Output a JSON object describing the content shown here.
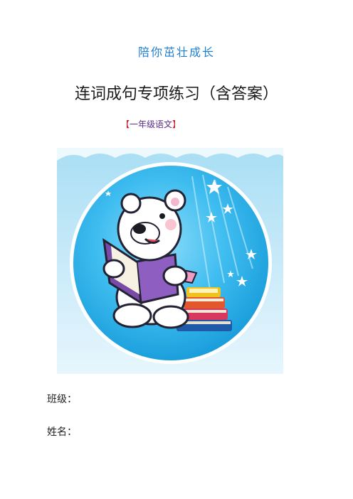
{
  "slogan": "陪你茁壮成长",
  "title": "连词成句专项练习（含答案）",
  "tag": {
    "open": "【",
    "text": "一年级语文",
    "close": "】"
  },
  "fields": {
    "class_label": "班级：",
    "name_label": "姓名："
  },
  "colors": {
    "slogan": "#1f7fd0",
    "tag_text": "#5a2a8a",
    "tag_bracket": "#c8242b",
    "circle_fill": "#38b9ee"
  },
  "illustration": "bear-reading-book-icon"
}
